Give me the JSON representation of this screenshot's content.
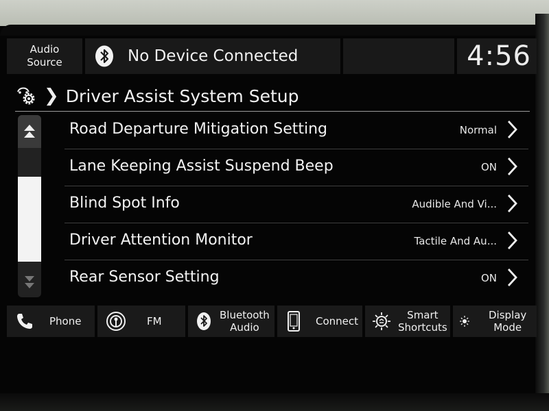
{
  "status_bar": {
    "audio_source_line1": "Audio",
    "audio_source_line2": "Source",
    "device_status": "No Device Connected",
    "clock": "4:56"
  },
  "breadcrumb": {
    "title": "Driver Assist System Setup"
  },
  "settings": [
    {
      "label": "Road Departure Mitigation Setting",
      "value": "Normal"
    },
    {
      "label": "Lane Keeping Assist Suspend Beep",
      "value": "ON"
    },
    {
      "label": "Blind Spot Info",
      "value": "Audible And Vi..."
    },
    {
      "label": "Driver Attention Monitor",
      "value": "Tactile And Au..."
    },
    {
      "label": "Rear Sensor Setting",
      "value": "ON"
    }
  ],
  "shortcuts": {
    "phone": "Phone",
    "fm": "FM",
    "bluetooth_audio_line1": "Bluetooth",
    "bluetooth_audio_line2": "Audio",
    "connect": "Connect",
    "smart_shortcuts_line1": "Smart",
    "smart_shortcuts_line2": "Shortcuts",
    "display_mode_line1": "Display",
    "display_mode_line2": "Mode"
  },
  "icons": {
    "audio_source": "none",
    "device": "bluetooth-icon",
    "breadcrumb": "car-gear-icon",
    "phone": "phone-icon",
    "fm": "radio-antenna-icon",
    "bluetooth_audio": "bluetooth-icon",
    "connect": "smartphone-icon",
    "smart_shortcuts": "smart-shortcuts-icon",
    "display_mode": "sun-moon-icon"
  },
  "colors": {
    "background": "#050505",
    "tile": "#191919",
    "text": "#f2f2f2"
  }
}
